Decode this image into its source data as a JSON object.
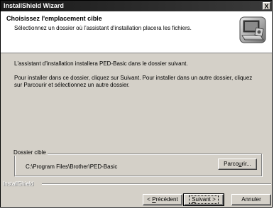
{
  "window": {
    "title": "InstallShield Wizard",
    "close_label": "X"
  },
  "header": {
    "title": "Choisissez l'emplacement cible",
    "subtitle": "Sélectionnez un dossier où l'assistant d'installation placera les fichiers.",
    "icon": "installer-computer-icon"
  },
  "body": {
    "line1": "L'assistant d'installation installera PED-Basic dans le dossier suivant.",
    "line2": "Pour installer dans ce dossier, cliquez sur Suivant. Pour installer dans un autre dossier, cliquez sur Parcourir et sélectionnez un autre dossier."
  },
  "destination": {
    "legend": "Dossier cible",
    "path": "C:\\Program Files\\Brother\\PED-Basic",
    "browse_pre": "Parco",
    "browse_ul": "u",
    "browse_post": "rir..."
  },
  "footer": {
    "brand": "InstallShield",
    "prev_pre": "< ",
    "prev_ul": "P",
    "prev_post": "récédent",
    "next_ul": "S",
    "next_post": "uivant >",
    "cancel": "Annuler"
  }
}
